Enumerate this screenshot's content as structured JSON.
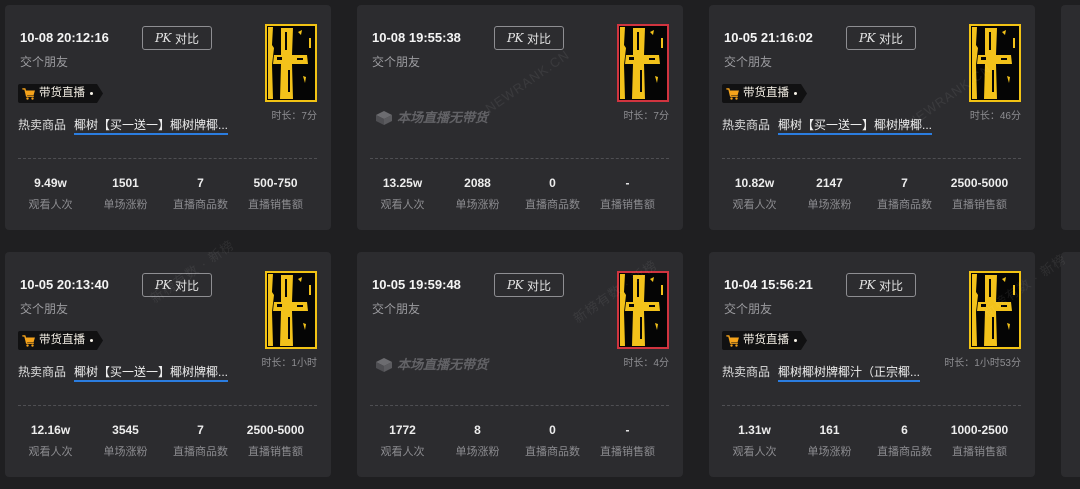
{
  "theme": {
    "page_bg": "#1f1f21",
    "card_bg": "#2c2c2f",
    "link_underline": "#2b7de0",
    "badge_icon": "#f5a31b",
    "badge_bg": "#111112"
  },
  "cards": [
    {
      "datetime": "10-08 20:12:16",
      "pk_button": {
        "prefix": "PK",
        "label": "对比"
      },
      "account": "交个朋友",
      "badge": {
        "icon": "shopping-cart-icon",
        "label": "带货直播"
      },
      "hot_goods": {
        "label": "热卖商品",
        "product": "椰树【买一送一】椰树牌椰..."
      },
      "cover": {
        "border_color": "#f2c314"
      },
      "duration": "时长：7分",
      "stats": [
        {
          "value": "9.49w",
          "label": "观看人次"
        },
        {
          "value": "1501",
          "label": "单场涨粉"
        },
        {
          "value": "7",
          "label": "直播商品数"
        },
        {
          "value": "500-750",
          "label": "直播销售额"
        }
      ]
    },
    {
      "datetime": "10-08 19:55:38",
      "pk_button": {
        "prefix": "PK",
        "label": "对比"
      },
      "account": "交个朋友",
      "no_goods": {
        "icon": "box-icon",
        "text": "本场直播无带货"
      },
      "cover": {
        "border_color": "#d1343f"
      },
      "duration": "时长：7分",
      "stats": [
        {
          "value": "13.25w",
          "label": "观看人次"
        },
        {
          "value": "2088",
          "label": "单场涨粉"
        },
        {
          "value": "0",
          "label": "直播商品数"
        },
        {
          "value": "-",
          "label": "直播销售额"
        }
      ]
    },
    {
      "datetime": "10-05 21:16:02",
      "pk_button": {
        "prefix": "PK",
        "label": "对比"
      },
      "account": "交个朋友",
      "badge": {
        "icon": "shopping-cart-icon",
        "label": "带货直播"
      },
      "hot_goods": {
        "label": "热卖商品",
        "product": "椰树【买一送一】椰树牌椰..."
      },
      "cover": {
        "border_color": "#f2c314"
      },
      "duration": "时长：46分",
      "stats": [
        {
          "value": "10.82w",
          "label": "观看人次"
        },
        {
          "value": "2147",
          "label": "单场涨粉"
        },
        {
          "value": "7",
          "label": "直播商品数"
        },
        {
          "value": "2500-5000",
          "label": "直播销售额"
        }
      ]
    },
    {
      "datetime": "10-05 20:13:40",
      "pk_button": {
        "prefix": "PK",
        "label": "对比"
      },
      "account": "交个朋友",
      "badge": {
        "icon": "shopping-cart-icon",
        "label": "带货直播"
      },
      "hot_goods": {
        "label": "热卖商品",
        "product": "椰树【买一送一】椰树牌椰..."
      },
      "cover": {
        "border_color": "#f2c314"
      },
      "duration": "时长：1小时",
      "stats": [
        {
          "value": "12.16w",
          "label": "观看人次"
        },
        {
          "value": "3545",
          "label": "单场涨粉"
        },
        {
          "value": "7",
          "label": "直播商品数"
        },
        {
          "value": "2500-5000",
          "label": "直播销售额"
        }
      ]
    },
    {
      "datetime": "10-05 19:59:48",
      "pk_button": {
        "prefix": "PK",
        "label": "对比"
      },
      "account": "交个朋友",
      "no_goods": {
        "icon": "box-icon",
        "text": "本场直播无带货"
      },
      "cover": {
        "border_color": "#d1343f"
      },
      "duration": "时长：4分",
      "stats": [
        {
          "value": "1772",
          "label": "观看人次"
        },
        {
          "value": "8",
          "label": "单场涨粉"
        },
        {
          "value": "0",
          "label": "直播商品数"
        },
        {
          "value": "-",
          "label": "直播销售额"
        }
      ]
    },
    {
      "datetime": "10-04 15:56:21",
      "pk_button": {
        "prefix": "PK",
        "label": "对比"
      },
      "account": "交个朋友",
      "badge": {
        "icon": "shopping-cart-icon",
        "label": "带货直播"
      },
      "hot_goods": {
        "label": "热卖商品",
        "product": "椰树椰树牌椰汁（正宗椰..."
      },
      "cover": {
        "border_color": "#f2c314"
      },
      "duration": "时长：1小时53分",
      "stats": [
        {
          "value": "1.31w",
          "label": "观看人次"
        },
        {
          "value": "161",
          "label": "单场涨粉"
        },
        {
          "value": "6",
          "label": "直播商品数"
        },
        {
          "value": "1000-2500",
          "label": "直播销售额"
        }
      ]
    }
  ],
  "watermarks": [
    "NEWRANK.CN",
    "NEWRANK.CN",
    "新榜有数 · 新榜",
    "新榜有数 · 新榜",
    "新榜有数 · 新榜"
  ]
}
